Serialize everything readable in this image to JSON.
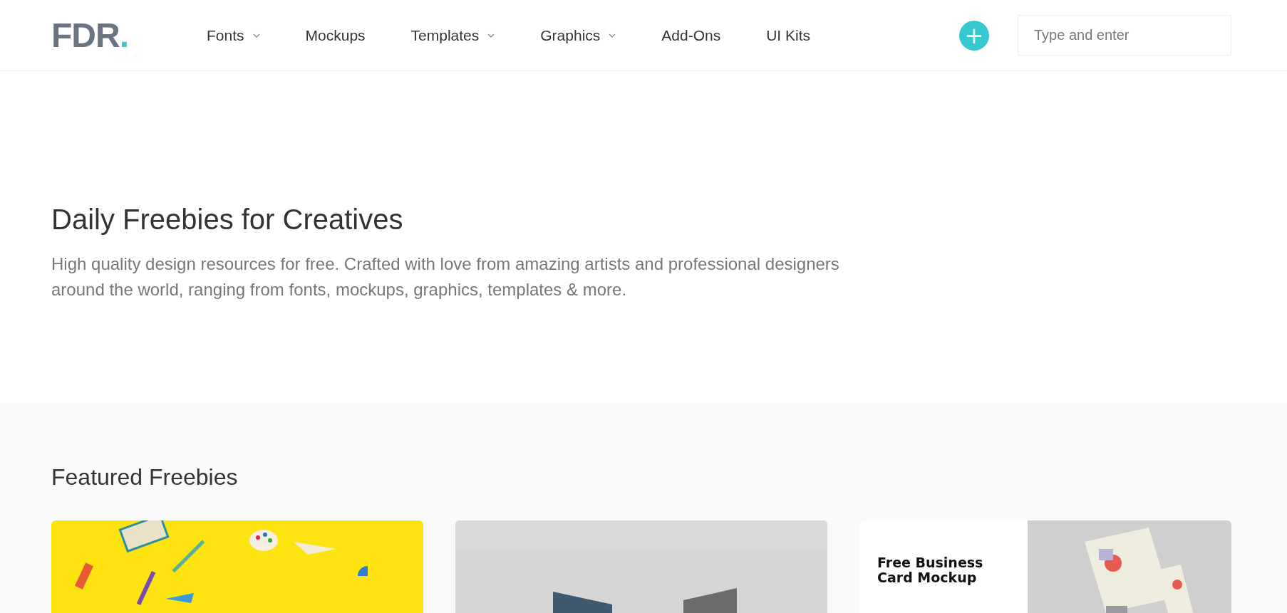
{
  "header": {
    "logo": {
      "text": "FDR",
      "dot": "."
    },
    "nav": [
      {
        "label": "Fonts",
        "has_dropdown": true
      },
      {
        "label": "Mockups",
        "has_dropdown": false
      },
      {
        "label": "Templates",
        "has_dropdown": true
      },
      {
        "label": "Graphics",
        "has_dropdown": true
      },
      {
        "label": "Add-Ons",
        "has_dropdown": false
      },
      {
        "label": "UI Kits",
        "has_dropdown": false
      }
    ],
    "add_button": "+",
    "search": {
      "placeholder": "Type and enter"
    }
  },
  "hero": {
    "title": "Daily Freebies for Creatives",
    "subtitle": "High quality design resources for free. Crafted with love from amazing artists and professional designers around the world, ranging from fonts, mockups, graphics, templates & more."
  },
  "featured": {
    "title": "Featured Freebies",
    "cards": [
      {
        "kind": "yellow"
      },
      {
        "kind": "gray"
      },
      {
        "kind": "split",
        "caption": "Free Business Card Mockup"
      }
    ]
  }
}
